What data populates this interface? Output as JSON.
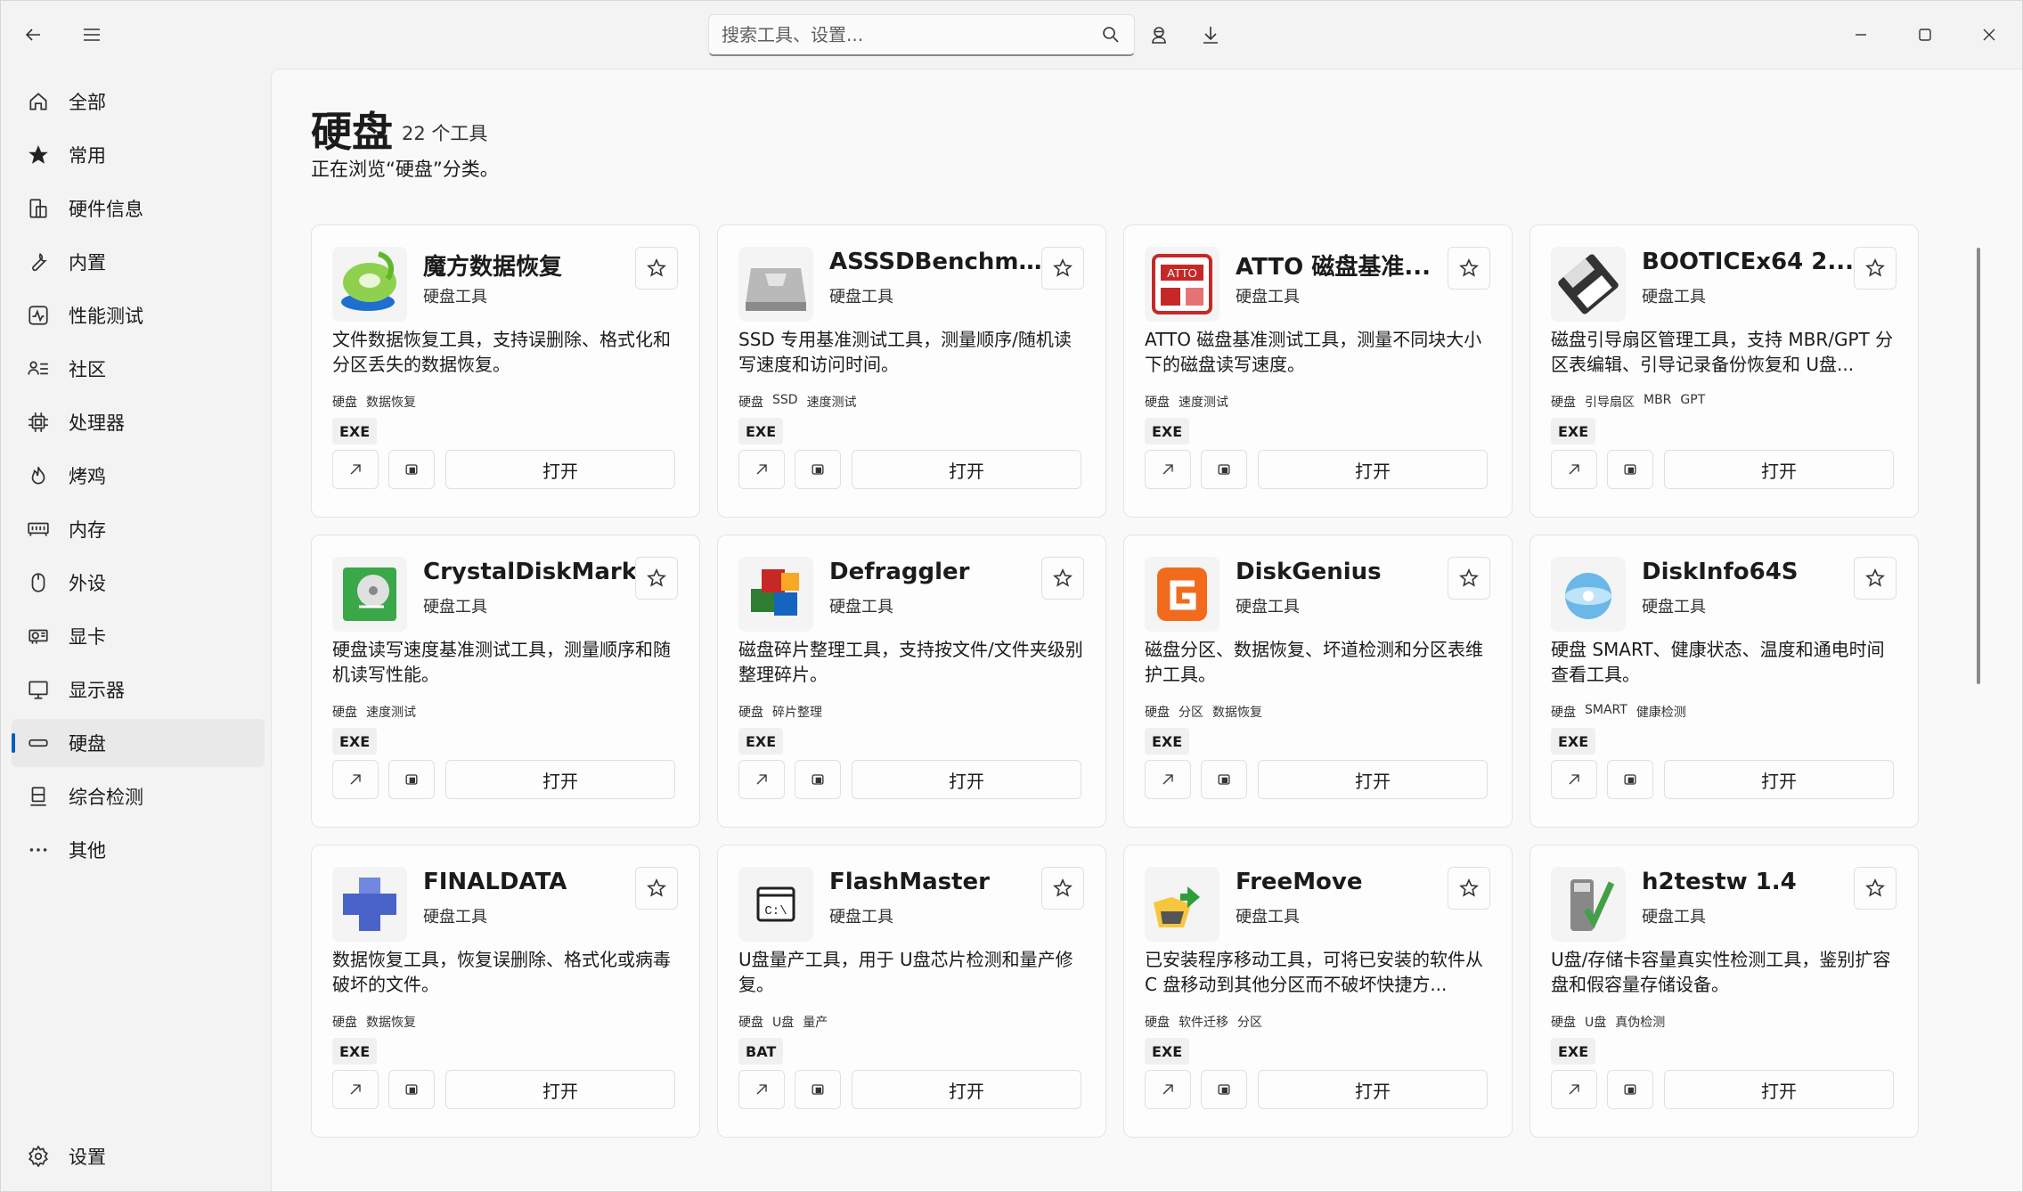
{
  "search": {
    "placeholder": "搜索工具、设置..."
  },
  "sidebar": {
    "items": [
      {
        "label": "全部",
        "icon": "home-icon"
      },
      {
        "label": "常用",
        "icon": "star-icon"
      },
      {
        "label": "硬件信息",
        "icon": "hardware-info-icon"
      },
      {
        "label": "内置",
        "icon": "wrench-icon"
      },
      {
        "label": "性能测试",
        "icon": "performance-icon"
      },
      {
        "label": "社区",
        "icon": "community-icon"
      },
      {
        "label": "处理器",
        "icon": "cpu-icon"
      },
      {
        "label": "烤鸡",
        "icon": "flame-icon"
      },
      {
        "label": "内存",
        "icon": "memory-icon"
      },
      {
        "label": "外设",
        "icon": "mouse-icon"
      },
      {
        "label": "显卡",
        "icon": "gpu-icon"
      },
      {
        "label": "显示器",
        "icon": "monitor-icon"
      },
      {
        "label": "硬盘",
        "icon": "disk-icon",
        "active": true
      },
      {
        "label": "综合检测",
        "icon": "diagnostics-icon"
      },
      {
        "label": "其他",
        "icon": "more-icon"
      }
    ],
    "settings_label": "设置"
  },
  "page": {
    "title": "硬盘",
    "count": "22 个工具",
    "subtitle": "正在浏览“硬盘”分类。"
  },
  "card_common": {
    "open_label": "打开"
  },
  "tools": [
    {
      "name": "魔方数据恢复",
      "category": "硬盘工具",
      "description": "文件数据恢复工具，支持误删除、格式化和分区丢失的数据恢复。",
      "tags": [
        "硬盘",
        "数据恢复"
      ],
      "type": "EXE",
      "icon": "mofang-recovery-icon"
    },
    {
      "name": "ASSSDBenchm...",
      "category": "硬盘工具",
      "description": "SSD 专用基准测试工具，测量顺序/随机读写速度和访问时间。",
      "tags": [
        "硬盘",
        "SSD",
        "速度测试"
      ],
      "type": "EXE",
      "icon": "as-ssd-icon"
    },
    {
      "name": "ATTO 磁盘基准...",
      "category": "硬盘工具",
      "description": "ATTO 磁盘基准测试工具，测量不同块大小下的磁盘读写速度。",
      "tags": [
        "硬盘",
        "速度测试"
      ],
      "type": "EXE",
      "icon": "atto-icon"
    },
    {
      "name": "BOOTICEx64 2...",
      "category": "硬盘工具",
      "description": "磁盘引导扇区管理工具，支持 MBR/GPT 分区表编辑、引导记录备份恢复和 U盘...",
      "tags": [
        "硬盘",
        "引导扇区",
        "MBR",
        "GPT"
      ],
      "type": "EXE",
      "icon": "bootice-icon"
    },
    {
      "name": "CrystalDiskMark",
      "category": "硬盘工具",
      "description": "硬盘读写速度基准测试工具，测量顺序和随机读写性能。",
      "tags": [
        "硬盘",
        "速度测试"
      ],
      "type": "EXE",
      "icon": "crystaldiskmark-icon"
    },
    {
      "name": "Defraggler",
      "category": "硬盘工具",
      "description": "磁盘碎片整理工具，支持按文件/文件夹级别整理碎片。",
      "tags": [
        "硬盘",
        "碎片整理"
      ],
      "type": "EXE",
      "icon": "defraggler-icon"
    },
    {
      "name": "DiskGenius",
      "category": "硬盘工具",
      "description": "磁盘分区、数据恢复、坏道检测和分区表维护工具。",
      "tags": [
        "硬盘",
        "分区",
        "数据恢复"
      ],
      "type": "EXE",
      "icon": "diskgenius-icon"
    },
    {
      "name": "DiskInfo64S",
      "category": "硬盘工具",
      "description": "硬盘 SMART、健康状态、温度和通电时间查看工具。",
      "tags": [
        "硬盘",
        "SMART",
        "健康检测"
      ],
      "type": "EXE",
      "icon": "diskinfo-icon"
    },
    {
      "name": "FINALDATA",
      "category": "硬盘工具",
      "description": "数据恢复工具，恢复误删除、格式化或病毒破坏的文件。",
      "tags": [
        "硬盘",
        "数据恢复"
      ],
      "type": "EXE",
      "icon": "finaldata-icon"
    },
    {
      "name": "FlashMaster",
      "category": "硬盘工具",
      "description": "U盘量产工具，用于 U盘芯片检测和量产修复。",
      "tags": [
        "硬盘",
        "U盘",
        "量产"
      ],
      "type": "BAT",
      "icon": "flashmaster-icon"
    },
    {
      "name": "FreeMove",
      "category": "硬盘工具",
      "description": "已安装程序移动工具，可将已安装的软件从 C 盘移动到其他分区而不破坏快捷方...",
      "tags": [
        "硬盘",
        "软件迁移",
        "分区"
      ],
      "type": "EXE",
      "icon": "freemove-icon"
    },
    {
      "name": "h2testw 1.4",
      "category": "硬盘工具",
      "description": "U盘/存储卡容量真实性检测工具，鉴别扩容盘和假容量存储设备。",
      "tags": [
        "硬盘",
        "U盘",
        "真伪检测"
      ],
      "type": "EXE",
      "icon": "h2testw-icon"
    }
  ]
}
